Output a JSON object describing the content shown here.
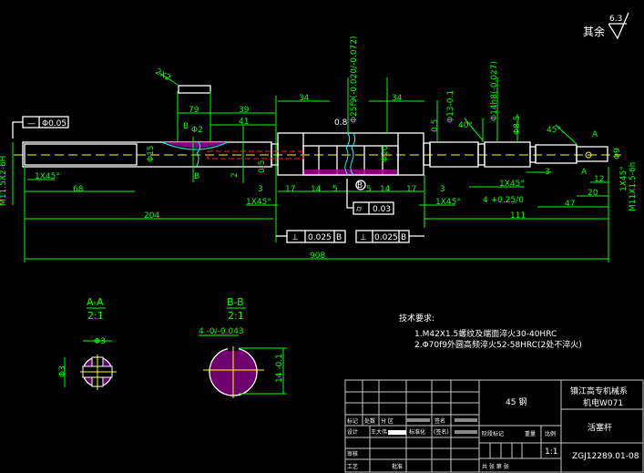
{
  "colors": {
    "background": "#000000",
    "dimension": "#00ff00",
    "outline": "#ffffff",
    "centerline": "#ffff00",
    "hatch": "#c000c0",
    "break_line": "#00ffff",
    "hidden": "#ff2020"
  },
  "surface_finish": {
    "label": "其余",
    "value": "6.3"
  },
  "dims": {
    "d68": "68",
    "d204": "204",
    "d908": "908",
    "d111": "111",
    "d79": "79",
    "d39": "39",
    "d41": "41",
    "d34a": "34",
    "d34b": "34",
    "d17a": "17",
    "d14a": "14",
    "d5a": "5",
    "d5b": "5",
    "d14b": "14",
    "d17b": "17",
    "d3a": "3",
    "d3b": "3",
    "d3c": "3",
    "d47": "47",
    "d20": "20",
    "d12": "12",
    "d05a": "0.5",
    "d05b": "0.5",
    "c1": "1X45°",
    "c2": "1X45°",
    "c3": "1X45°",
    "c4": "1X45°",
    "c5": "1X45°",
    "thread_left": "M11.5X2-6H",
    "thread_right": "M11X1.5-6h",
    "phi15": "Φ15",
    "phi2": "Φ2",
    "phi20": "Φ20",
    "phi25": "Φ25f9(-0.020/-0.072)",
    "phi13": "Φ13-0.1",
    "phi14": "Φ14h8(-0.027)",
    "phi85": "Φ8.5",
    "phi9": "Φ9",
    "w2": "2",
    "ang": "40°",
    "ang2": "45°",
    "groove": "4 +0.25/0",
    "slot": "2X2",
    "rough": "0.8",
    "secB": "B",
    "secB2": "B",
    "secA": "A",
    "secA2": "A",
    "datumB": "B"
  },
  "tolerances": {
    "straightness": {
      "symbol": "—",
      "value": "Φ0.05"
    },
    "cylindricity": {
      "symbol": "⌭",
      "value": "0.03"
    },
    "perp1": {
      "symbol": "⊥",
      "value": "0.025",
      "datum": "B"
    },
    "perp2": {
      "symbol": "⊥",
      "value": "0.025",
      "datum": "B"
    }
  },
  "sections": {
    "aa": {
      "title": "A-A",
      "scale": "2:1",
      "dim_w": "Φ3",
      "dim_h": "Φ3"
    },
    "bb": {
      "title": "B-B",
      "scale": "2:1",
      "dim_key": "4 -0/-0.043",
      "dim_h": "14 -0.1"
    }
  },
  "requirements": {
    "title": "技术要求:",
    "items": [
      "1.M42X1.5螺纹及端面淬火30-40HRC",
      "2.Φ70f9外圆高频淬火52-58HRC(2处不淬火)"
    ]
  },
  "title_block": {
    "material": "45 钢",
    "school": "镇江高专机械系",
    "class": "机电W071",
    "part_name": "活塞杆",
    "drawing_no": "ZGJ12289.01-08",
    "scale": "1:1",
    "labels": {
      "mark": "标记",
      "count": "处数",
      "zone": "分 区",
      "sign": "签名",
      "design": "设计",
      "designer": "王大伟",
      "standard": "标准化",
      "signed": "(签名)",
      "stage": "阶段标记",
      "weight": "重量",
      "ratio": "比例",
      "review": "审核",
      "process": "工艺",
      "approve": "批准",
      "sheets": "共   张   第   张"
    }
  }
}
